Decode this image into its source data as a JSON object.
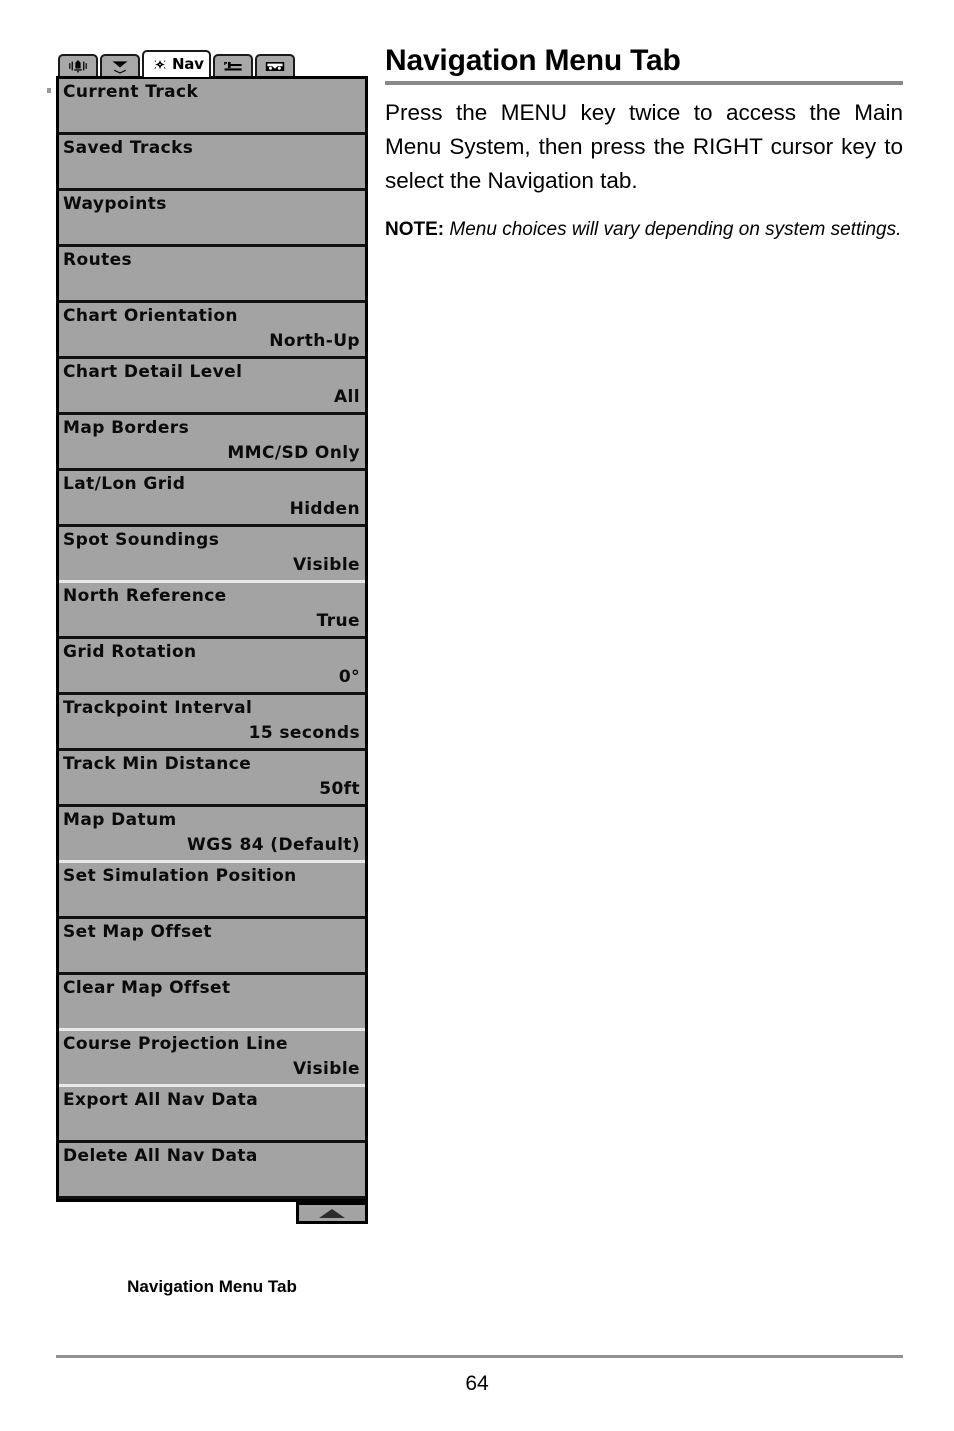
{
  "page": {
    "title": "Navigation Menu Tab",
    "number": "64"
  },
  "content": {
    "intro": "Press the MENU key twice to access the Main Menu System, then press the RIGHT cursor key to select the Navigation tab.",
    "note_lead": "NOTE:",
    "note_text": " Menu choices will vary depending on system settings."
  },
  "figure": {
    "caption": "Navigation Menu Tab",
    "scroll_indicator": "scroll-up-arrow"
  },
  "device": {
    "tabs": [
      {
        "name": "alarms",
        "icon": "alarm-bell-icon",
        "label": "",
        "active": false
      },
      {
        "name": "sonar",
        "icon": "sonar-beam-icon",
        "label": "",
        "active": false
      },
      {
        "name": "navigation",
        "icon": "nav-compass-icon",
        "label": "Nav",
        "active": true
      },
      {
        "name": "setup",
        "icon": "wrench-setup-icon",
        "label": "",
        "active": false
      },
      {
        "name": "views",
        "icon": "screen-views-icon",
        "label": "",
        "active": false
      }
    ],
    "menu_items": [
      {
        "label": "Current Track",
        "value": ""
      },
      {
        "label": "Saved Tracks",
        "value": ""
      },
      {
        "label": "Waypoints",
        "value": ""
      },
      {
        "label": "Routes",
        "value": ""
      },
      {
        "label": "Chart Orientation",
        "value": "North-Up"
      },
      {
        "label": "Chart Detail Level",
        "value": "All"
      },
      {
        "label": "Map Borders",
        "value": "MMC/SD Only"
      },
      {
        "label": "Lat/Lon Grid",
        "value": "Hidden"
      },
      {
        "label": "Spot Soundings",
        "value": "Visible"
      },
      {
        "label": "North Reference",
        "value": "True"
      },
      {
        "label": "Grid Rotation",
        "value": "0°"
      },
      {
        "label": "Trackpoint Interval",
        "value": "15 seconds"
      },
      {
        "label": "Track Min Distance",
        "value": "50ft"
      },
      {
        "label": "Map Datum",
        "value": "WGS 84 (Default)"
      },
      {
        "label": "Set Simulation Position",
        "value": ""
      },
      {
        "label": "Set Map Offset",
        "value": ""
      },
      {
        "label": "Clear Map Offset",
        "value": ""
      },
      {
        "label": "Course Projection Line",
        "value": "Visible"
      },
      {
        "label": "Export All Nav Data",
        "value": ""
      },
      {
        "label": "Delete All Nav Data",
        "value": ""
      }
    ]
  },
  "colors": {
    "menu_background": "#a3a3a3",
    "menu_border": "#111111",
    "rule": "#8a8a8a",
    "text": "#000000"
  }
}
